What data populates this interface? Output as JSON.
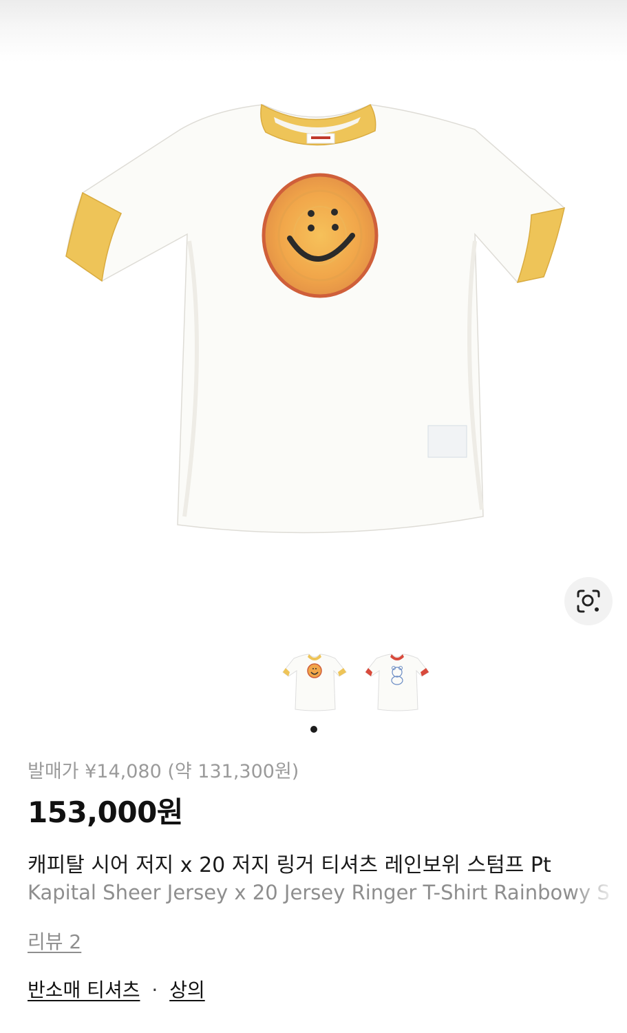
{
  "product": {
    "release_label": "발매가 ¥14,080 (약 131,300원)",
    "price": "153,000원",
    "name_ko": "캐피탈 시어 저지 x 20 저지 링거 티셔츠 레인보위 스텀프 Pt",
    "name_en": "Kapital Sheer Jersey x 20 Jersey Ringer T-Shirt Rainbowy S",
    "review": "리뷰 2",
    "categories": [
      "반소매 티셔츠",
      "상의"
    ],
    "category_separator": "·"
  },
  "gallery": {
    "image_count": 2,
    "active_index": 0,
    "lens_icon": "visual-search-icon",
    "colors": {
      "shirt": "#fbfbf8",
      "trim_main": "#eec458",
      "trim_alt": "#d84a3c"
    }
  }
}
